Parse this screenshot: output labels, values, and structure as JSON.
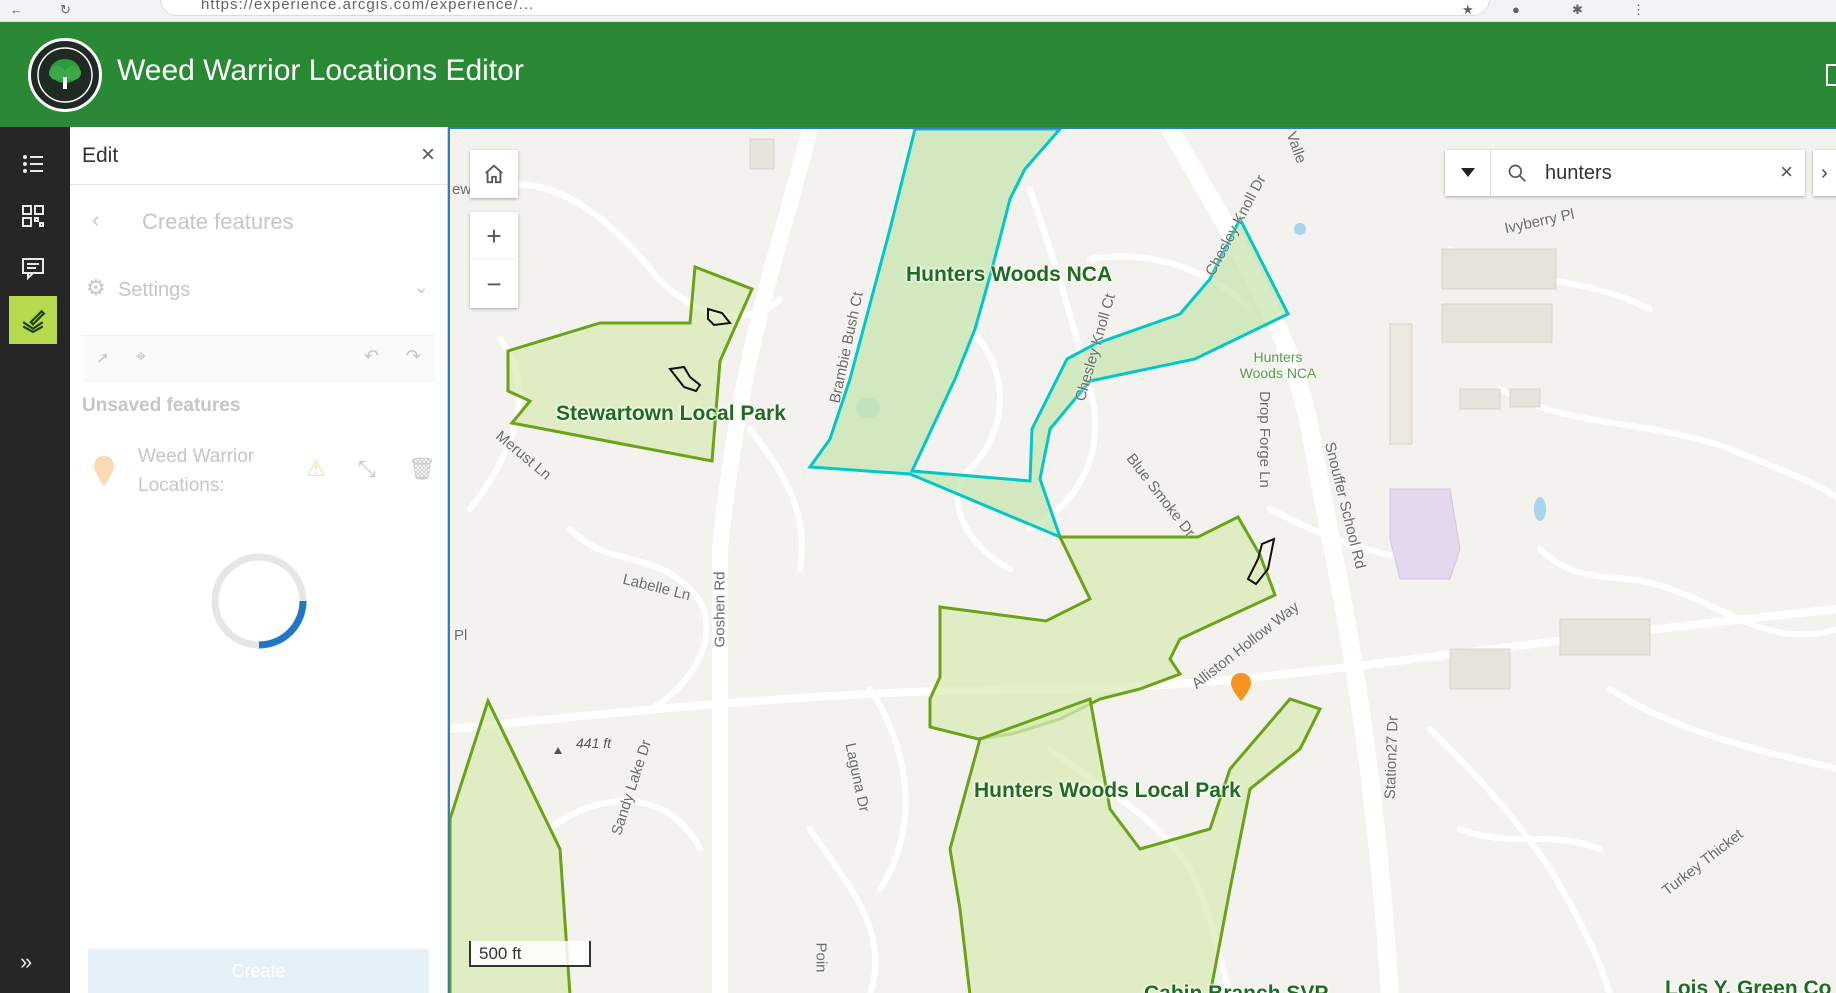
{
  "app": {
    "title": "Weed Warrior Locations Editor",
    "accent": "#2a8934"
  },
  "browser": {
    "url_text": "https://experience.arcgis.com/experience/..."
  },
  "action_bar": {
    "items": [
      {
        "name": "layer-list-icon"
      },
      {
        "name": "qr-grid-icon"
      },
      {
        "name": "chat-icon"
      },
      {
        "name": "edit-pencil-icon",
        "active": true
      }
    ]
  },
  "edit_panel": {
    "title": "Edit",
    "back_label": "Create features",
    "settings_label": "Settings",
    "unsaved_label": "Unsaved features",
    "feature_label": "Weed Warrior Locations:",
    "create_label": "Create"
  },
  "search": {
    "value": "hunters"
  },
  "map": {
    "scale_label": "500 ft",
    "parks": [
      {
        "id": "hunters-woods-nca",
        "label": "Hunters Woods NCA"
      },
      {
        "id": "stewartown-local-park",
        "label": "Stewartown Local Park"
      },
      {
        "id": "hunters-woods-local-park",
        "label": "Hunters Woods Local Park"
      },
      {
        "id": "cabin-branch-svp",
        "label": "Cabin Branch SVP"
      },
      {
        "id": "lois-y-green",
        "label": "Lois Y. Green Co"
      }
    ],
    "small_labels": [
      "Hunters Woods NCA",
      "Stewartown Local Park",
      "Hunters Woods Local Park"
    ],
    "streets": [
      "Chesley Knoll Dr",
      "Chesley Knoll Ct",
      "Brambie Bush Ct",
      "Ivyberry Pl",
      "Merust Ln",
      "Goshen Rd",
      "Labelle Ln",
      "Blue Smoke Dr",
      "Drop Forge Ln",
      "Snouffer School Rd",
      "Alliston Hollow Way",
      "Sandy Lake Dr",
      "Laguna Dr",
      "Station27 Dr",
      "Turkey Thicket",
      "Pl",
      "Poin",
      "ew",
      "Valle"
    ],
    "spot_height": "441 ft"
  }
}
